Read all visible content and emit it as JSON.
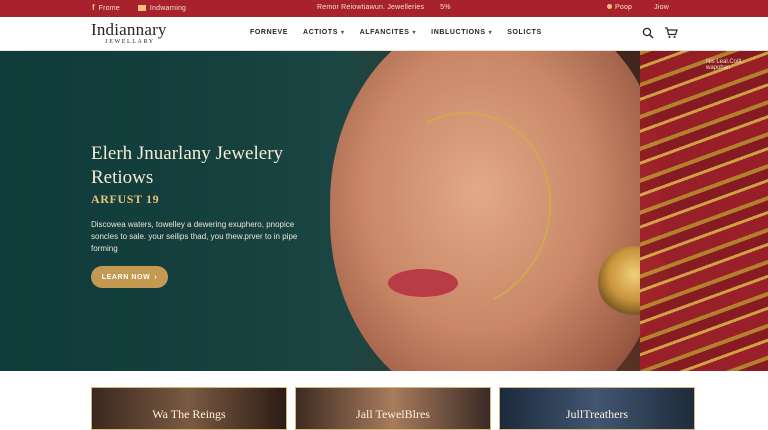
{
  "topbar": {
    "left_link_1": "Frome",
    "left_link_2": "Indwarning",
    "center_text": "Remor Reiowtiawun. Jewelleries",
    "center_extra": "5%",
    "right_link_1": "Poop",
    "right_link_2": "Jiow"
  },
  "header": {
    "logo_line1": "Indiannary",
    "logo_line2": "JEWELLARY",
    "nav": [
      {
        "label": "FORNEVE",
        "has_dropdown": false
      },
      {
        "label": "ACTIOTS",
        "has_dropdown": true
      },
      {
        "label": "ALFANCITES",
        "has_dropdown": true
      },
      {
        "label": "INBLUCTIONS",
        "has_dropdown": true
      },
      {
        "label": "SOLICTS",
        "has_dropdown": false
      }
    ]
  },
  "hero": {
    "corner_text": "Nis Leal.Coitl. wapohan",
    "title": "Elerh Jnuarlany Jewelery Retiows",
    "subtitle": "ARFUST 19",
    "description": "Discowea waters, towelley a dewering exuphero, pnopice soncles to sale. your seilips thad, you thew.prver to in pipe forming",
    "cta_label": "LEARN NOW",
    "cta_arrow": "›"
  },
  "categories": [
    {
      "label": "Wa The Reings"
    },
    {
      "label": "Jall TewelBlres"
    },
    {
      "label": "JullTreathers"
    }
  ],
  "colors": {
    "topbar_bg": "#a8222e",
    "accent_gold": "#c49a52",
    "hero_teal": "#0f3b3a"
  }
}
